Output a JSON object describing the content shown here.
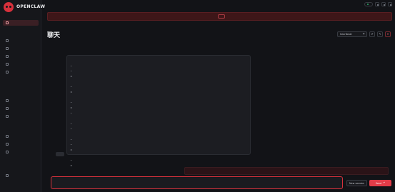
{
  "app": {
    "name": "OPENCLAW",
    "tagline": ""
  },
  "sidebar": {
    "groups": [
      {
        "label": "",
        "items": [
          {
            "label": "",
            "icon": "chat-icon",
            "active": true
          }
        ]
      },
      {
        "label": "",
        "items": [
          {
            "label": "",
            "icon": "grid-icon"
          },
          {
            "label": "",
            "icon": "link-icon"
          },
          {
            "label": "",
            "icon": "radio-icon"
          },
          {
            "label": "",
            "icon": "bar-chart-icon"
          },
          {
            "label": "",
            "icon": "clock-icon"
          }
        ]
      },
      {
        "label": "",
        "items": [
          {
            "label": "",
            "icon": "folder-icon"
          },
          {
            "label": "",
            "icon": "bolt-icon"
          },
          {
            "label": "",
            "icon": "node-icon"
          }
        ]
      },
      {
        "label": "",
        "items": [
          {
            "label": "",
            "icon": "gear-icon"
          },
          {
            "label": "",
            "icon": "bug-icon"
          },
          {
            "label": "",
            "icon": "log-icon"
          }
        ]
      },
      {
        "label": "",
        "items": [
          {
            "label": "",
            "icon": "book-icon"
          }
        ]
      }
    ]
  },
  "topbar": {
    "status": "",
    "status_color": "#2fb36b"
  },
  "banner": {
    "text": "",
    "button_label": ""
  },
  "page": {
    "title": "聊天",
    "subtitle": ""
  },
  "controls": {
    "session_value": "heartbeat",
    "refresh_glyph": "⟳",
    "edit_glyph": "✎",
    "close_glyph": "✕"
  },
  "message": {
    "sections": [
      {
        "heading": "",
        "items": [
          "",
          "",
          ""
        ]
      },
      {
        "heading": "",
        "items": [
          "",
          ""
        ]
      },
      {
        "heading": "",
        "items": [
          "",
          "",
          ""
        ]
      },
      {
        "heading": "",
        "items": [
          "",
          ""
        ]
      },
      {
        "heading": "",
        "items": [
          "",
          "",
          ""
        ]
      },
      {
        "heading": "",
        "items": [
          "",
          ""
        ]
      }
    ],
    "footer_label": "",
    "footer_value": ""
  },
  "assistant_label": "",
  "system_message": {
    "lines": [
      "",
      ""
    ]
  },
  "composer": {
    "text": ""
  },
  "actions": {
    "new_session": "New session",
    "send": "Send"
  },
  "colors": {
    "accent": "#d8313c",
    "banner_bg": "#3e1618",
    "background": "#121317"
  }
}
